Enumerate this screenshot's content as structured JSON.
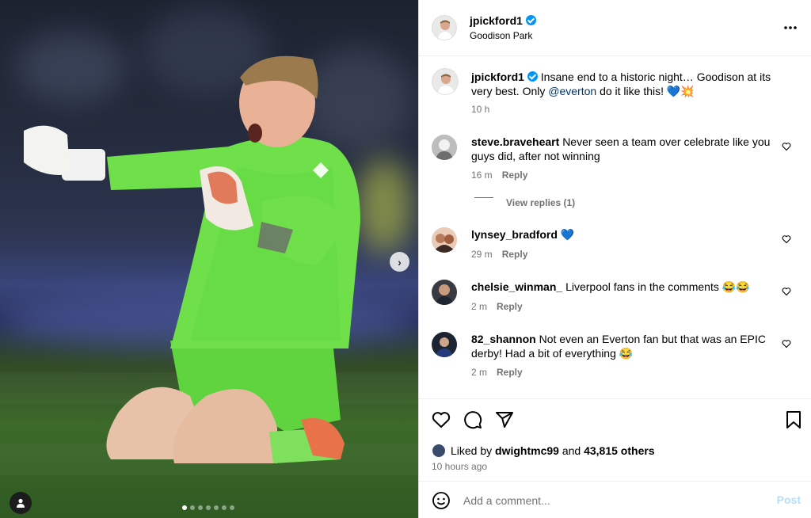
{
  "post": {
    "author": "jpickford1",
    "location": "Goodison Park",
    "caption_before": "Insane end to a historic night… Goodison at its very best. Only ",
    "caption_mention": "@everton",
    "caption_after": " do it like this! 💙💥",
    "caption_age": "10 h",
    "carousel_total": 7,
    "carousel_index": 1
  },
  "header": {
    "more_icon": "more-horizontal-icon"
  },
  "comments": [
    {
      "user": "steve.braveheart",
      "text": "Never seen a team over celebrate like you guys did, after not winning",
      "age": "16 m",
      "reply": "Reply",
      "view_replies": "View replies (1)"
    },
    {
      "user": "lynsey_bradford",
      "text": "💙",
      "age": "29 m",
      "reply": "Reply"
    },
    {
      "user": "chelsie_winman_",
      "text": "Liverpool fans in the comments 😂😂",
      "age": "2 m",
      "reply": "Reply"
    },
    {
      "user": "82_shannon",
      "text": "Not even an Everton fan but that was an EPIC derby! Had a bit of everything 😂",
      "age": "2 m",
      "reply": "Reply"
    }
  ],
  "actions": {
    "liked_prefix": "Liked by ",
    "liked_user": "dwightmc99",
    "liked_and": " and ",
    "liked_others": "43,815 others",
    "time": "10 hours ago"
  },
  "composer": {
    "placeholder": "Add a comment...",
    "post_label": "Post"
  },
  "colors": {
    "accent": "#0095f6",
    "post_disabled": "#b2dffc",
    "jersey": "#6fe04a"
  }
}
